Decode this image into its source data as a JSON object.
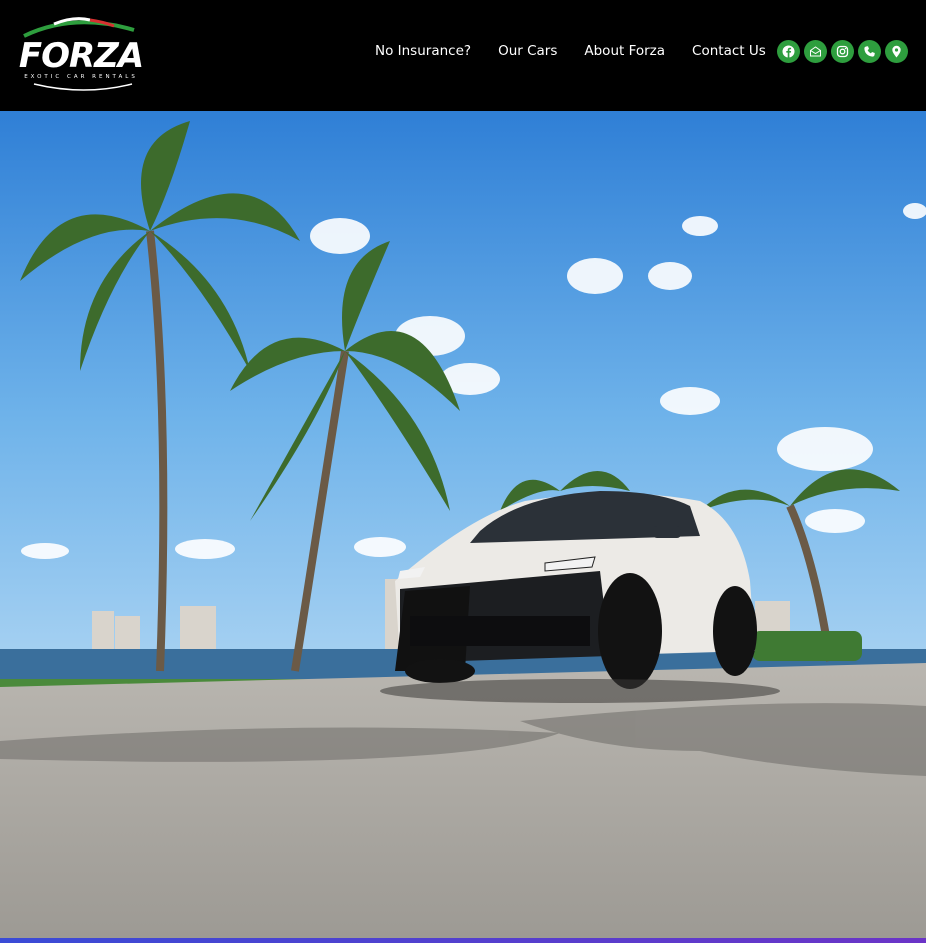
{
  "brand": {
    "name": "FORZA",
    "tagline": "EXOTIC CAR RENTALS"
  },
  "nav": {
    "items": [
      {
        "label": "No Insurance?"
      },
      {
        "label": "Our Cars"
      },
      {
        "label": "About Forza"
      },
      {
        "label": "Contact Us"
      }
    ]
  },
  "social": {
    "accent": "#2e9e3e",
    "icons": [
      "facebook-icon",
      "email-icon",
      "instagram-icon",
      "phone-icon",
      "location-pin-icon"
    ]
  },
  "hero": {
    "image": "white-suv-palm-trees-waterfront"
  }
}
